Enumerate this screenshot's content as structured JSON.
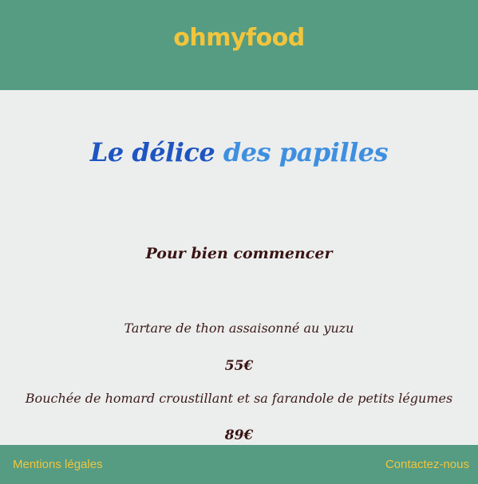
{
  "header": {
    "logo": "ohmyfood"
  },
  "menu": {
    "title_part1": "Le délice ",
    "title_part2": "des papilles",
    "section_title": "Pour bien commencer",
    "dishes": [
      {
        "name": "Tartare de thon assaisonné au yuzu",
        "price": "55€"
      },
      {
        "name": "Bouchée de homard croustillant et sa farandole de petits légumes",
        "price": "89€"
      }
    ]
  },
  "footer": {
    "legal_label": "Mentions légales",
    "contact_label": "Contactez-nous"
  },
  "colors": {
    "header_bg": "#559c82",
    "accent_yellow": "#f2c53c",
    "page_bg": "#eceeed"
  }
}
